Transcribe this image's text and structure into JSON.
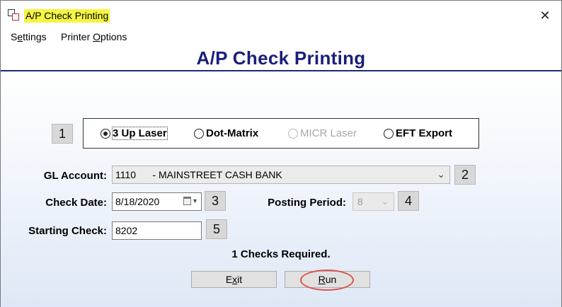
{
  "window": {
    "title": "A/P Check Printing",
    "close_glyph": "✕"
  },
  "menu": {
    "settings_pre": "S",
    "settings_u": "e",
    "settings_post": "ttings",
    "printer_pre": "Printer ",
    "printer_u": "O",
    "printer_post": "ptions"
  },
  "header": {
    "title": "A/P Check Printing"
  },
  "badges": [
    "1",
    "2",
    "3",
    "4",
    "5"
  ],
  "print_type": {
    "options": [
      {
        "label": "3 Up Laser",
        "checked": true,
        "disabled": false
      },
      {
        "label": "Dot-Matrix",
        "checked": false,
        "disabled": false
      },
      {
        "label": "MICR Laser",
        "checked": false,
        "disabled": true
      },
      {
        "label": "EFT Export",
        "checked": false,
        "disabled": false
      }
    ]
  },
  "gl_account": {
    "label": "GL Account:",
    "value": "1110      - MAINSTREET CASH BANK"
  },
  "check_date": {
    "label": "Check Date:",
    "value": "8/18/2020"
  },
  "posting_period": {
    "label": "Posting Period:",
    "value": "8"
  },
  "starting_check": {
    "label": "Starting Check:",
    "value": "8202"
  },
  "summary": "1 Checks Required.",
  "buttons": {
    "exit_pre": "E",
    "exit_u": "x",
    "exit_post": "it",
    "run_pre": "",
    "run_u": "R",
    "run_post": "un"
  },
  "colors": {
    "header_title": "#1a1f7a",
    "title_highlight": "#f5f542",
    "annotation": "#d9534f"
  },
  "icons": [
    "app-icon",
    "close-icon",
    "chevron-down-icon",
    "calendar-icon"
  ]
}
